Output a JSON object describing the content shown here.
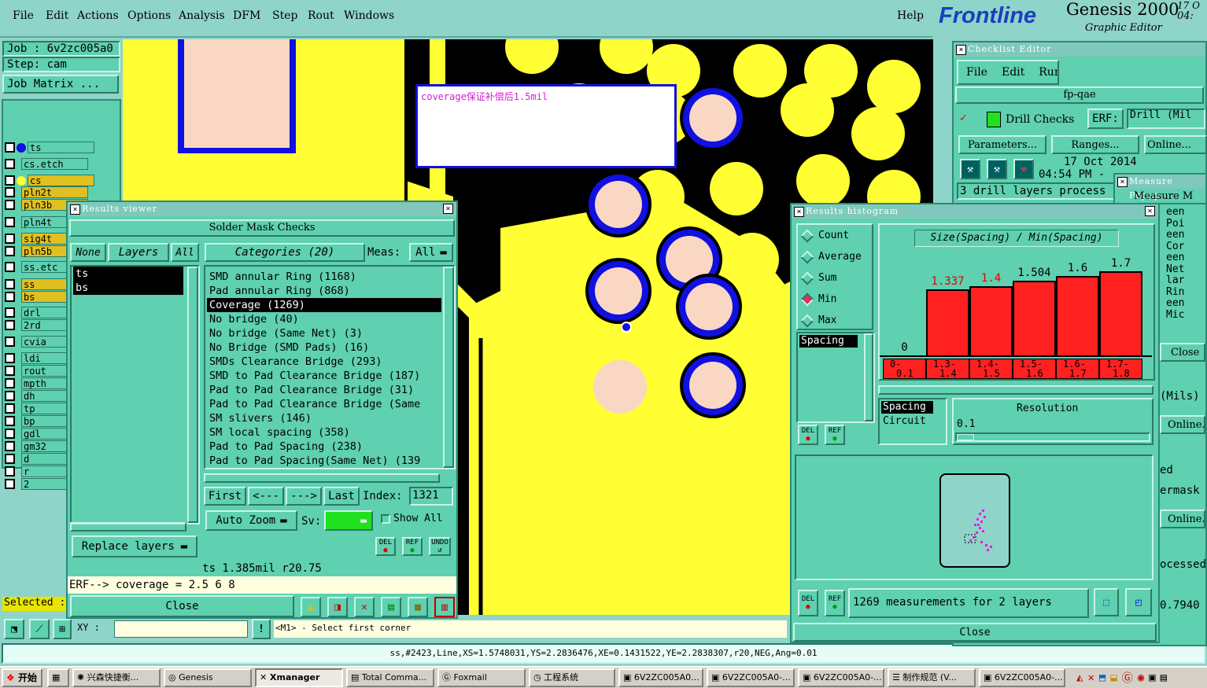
{
  "menubar": {
    "items": [
      "File",
      "Edit",
      "Actions",
      "Options",
      "Analysis",
      "DFM",
      "Step",
      "Rout",
      "Windows"
    ],
    "help": "Help",
    "logo": "Frontline",
    "app_title": "Genesis 2000",
    "app_subtitle": "Graphic Editor",
    "date_fragment": "17 O",
    "time_fragment": "04:"
  },
  "left": {
    "job": "Job : 6v2zc005a0",
    "step": "Step: cam",
    "job_matrix": "Job Matrix ...",
    "layers": [
      "ts",
      "cs.etch",
      "cs",
      "pln2t",
      "pln3b",
      "pln4t",
      "sig4t",
      "pln5b",
      "ss.etc",
      "ss",
      "bs",
      "drl",
      "2rd",
      "cvia",
      "ldi",
      "rout",
      "mpth",
      "dh",
      "tp",
      "bp",
      "gdl",
      "gm32",
      "d",
      "r",
      "2"
    ],
    "selected_label": "Selected :"
  },
  "canvas": {
    "note": "coverage保证补偿后1.5mil"
  },
  "results_viewer": {
    "title": "Results viewer",
    "header": "Solder Mask Checks",
    "none_btn": "None",
    "layers_btn": "Layers",
    "all_btn": "All",
    "categories_btn": "Categories (20)",
    "meas_label": "Meas:",
    "meas_value": "All",
    "layer_list": [
      "ts",
      "bs"
    ],
    "categories": [
      "SMD annular Ring (1168)",
      "Pad annular Ring (868)",
      "Coverage (1269)",
      "No bridge (40)",
      "No bridge (Same Net) (3)",
      "No Bridge (SMD Pads) (16)",
      "SMDs Clearance Bridge (293)",
      "SMD to Pad Clearance Bridge (187)",
      "Pad to Pad Clearance Bridge (31)",
      "Pad to Pad Clearance Bridge (Same",
      "SM slivers (146)",
      "SM local spacing (358)",
      "Pad to Pad Spacing (238)",
      "Pad to Pad Spacing(Same Net) (139"
    ],
    "first_btn": "First",
    "prev_btn": "<---",
    "next_btn": "--->",
    "last_btn": "Last",
    "index_label": "Index:",
    "index_value": "1321",
    "auto_zoom": "Auto Zoom",
    "sv_label": "Sv:",
    "show_all": "Show All",
    "replace_layers": "Replace layers",
    "del_btn": "DEL",
    "ref_btn": "REF",
    "undo_btn": "UNDO",
    "status": "ts 1.385mil  r20.75",
    "erf_line": "ERF--> coverage = 2.5 6 8",
    "close_btn": "Close"
  },
  "coordbar": {
    "xy_label": "XY :",
    "prompt": "<M1> - Select first corner",
    "status": "ss,#2423,Line,XS=1.5748031,YS=2.2836476,XE=0.1431522,YE=2.2838307,r20,NEG,Ang=0.01"
  },
  "checklist": {
    "title": "Checklist Editor",
    "menu": [
      "File",
      "Edit",
      "Run"
    ],
    "name": "fp-qae",
    "drill_checks": "Drill Checks",
    "erf_label": "ERF:",
    "erf_value": "Drill (Mil",
    "params_btn": "Parameters...",
    "ranges_btn": "Ranges...",
    "online_btn": "Online...",
    "date": "17 Oct 2014",
    "time": "04:54 PM - ",
    "process_line": "3 drill layers process",
    "right_fragments": [
      "een Poi",
      "een Cor",
      "een Net",
      "lar Rin",
      "een Mic"
    ],
    "close_btn": "Close",
    "mils_fragment": "(Mils)",
    "online2": "Online...",
    "ed_fragment": "ed",
    "ermask": "ermask",
    "online3": "Online...",
    "ocessed": "ocessed",
    "num_fragment": "0.7940"
  },
  "measure_popup": {
    "title": "Measure Popup",
    "label": "Measure M"
  },
  "histogram": {
    "title": "Results histogram",
    "options": [
      "Count",
      "Average",
      "Sum",
      "Min",
      "Max"
    ],
    "selected_option": "Min",
    "chart_title": "Size(Spacing) / Min(Spacing)",
    "list_selected": "Spacing",
    "bins": [
      "0-\n0.1",
      "1.3-\n1.4",
      "1.4-\n1.5",
      "1.5-\n1.6",
      "1.6-\n1.7",
      "1.7-\n1.8"
    ],
    "bin_top": [
      "0-",
      "1.3-",
      "1.4-",
      "1.5-",
      "1.6-",
      "1.7-"
    ],
    "bin_bottom": [
      "0.1",
      "1.4",
      "1.5",
      "1.6",
      "1.7",
      "1.8"
    ],
    "values": [
      "0",
      "1.337",
      "1.4",
      "1.504",
      "1.6",
      "1.7"
    ],
    "value_colors": [
      "#000000",
      "#e00000",
      "#e00000",
      "#000000",
      "#000000",
      "#000000"
    ],
    "bar_fraction": [
      0,
      0.7,
      0.73,
      0.79,
      0.84,
      0.89
    ],
    "type_list": [
      "Spacing",
      "Circuit"
    ],
    "resolution_label": "Resolution",
    "resolution_value": "0.1",
    "del_btn": "DEL",
    "ref_btn": "REF",
    "summary": "1269 measurements for 2 layers",
    "close_btn": "Close"
  },
  "taskbar": {
    "start": "开始",
    "items": [
      "兴森快捷衡...",
      "Genesis",
      "Xmanager",
      "Total Comma...",
      "Foxmail",
      "工程系统",
      "6V2ZC005A0...",
      "6V2ZC005A0-...",
      "6V2ZC005A0-...",
      "制作规范 (V...",
      "6V2ZC005A0-..."
    ]
  },
  "colors": {
    "teal": "#5fd0b0",
    "pcb_yellow": "#ffff33",
    "pad_pink": "#f9d7c3",
    "pad_ring": "#1010e0",
    "bar_red": "#ff2020"
  }
}
